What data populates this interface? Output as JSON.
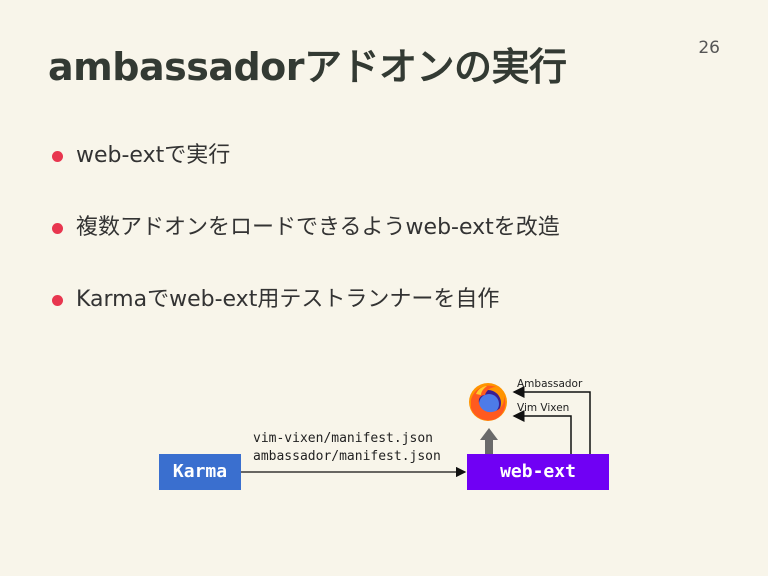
{
  "slide": {
    "title": "ambassadorアドオンの実行",
    "page_number": "26"
  },
  "bullets": [
    {
      "text": "web-extで実行"
    },
    {
      "text": "複数アドオンをロードできるようweb-extを改造"
    },
    {
      "text": "Karmaでweb-ext用テストランナーを自作"
    }
  ],
  "diagram": {
    "karma_label": "Karma",
    "webext_label": "web-ext",
    "manifest_line1": "vim-vixen/manifest.json",
    "manifest_line2": "ambassador/manifest.json",
    "addon_ambassador": "Ambassador",
    "addon_vimvixen": "Vim Vixen",
    "browser_icon": "firefox-icon"
  },
  "colors": {
    "background": "#f8f5ea",
    "bullet_dot": "#e8364f",
    "karma_box": "#3a6fcf",
    "webext_box": "#7000f4"
  }
}
